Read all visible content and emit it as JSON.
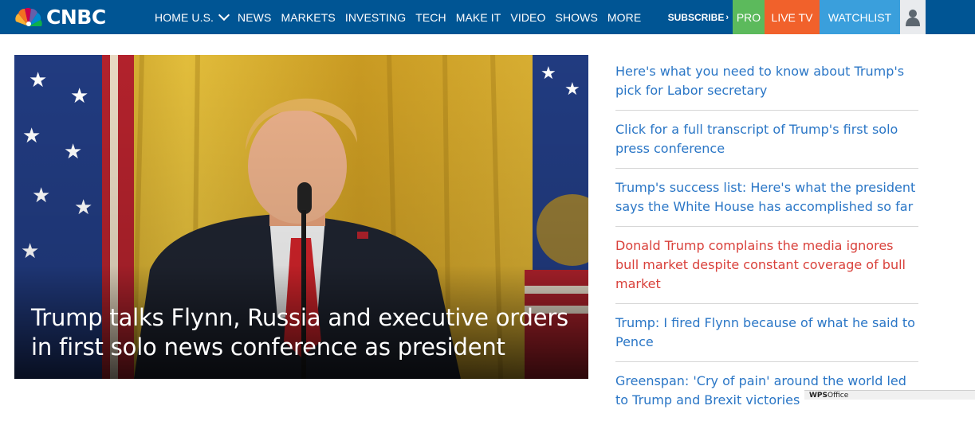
{
  "nav": {
    "logo_text": "CNBC",
    "menu": [
      {
        "label": "HOME U.S.",
        "has_dropdown": true
      },
      {
        "label": "NEWS"
      },
      {
        "label": "MARKETS"
      },
      {
        "label": "INVESTING"
      },
      {
        "label": "TECH"
      },
      {
        "label": "MAKE IT"
      },
      {
        "label": "VIDEO"
      },
      {
        "label": "SHOWS"
      },
      {
        "label": "MORE"
      }
    ],
    "subscribe_label": "SUBSCRIBE",
    "subscribe_arrow": "›",
    "pro_label": "PRO",
    "livetv_label": "LIVE TV",
    "watchlist_label": "WATCHLIST",
    "colors": {
      "bar": "#005594",
      "pro": "#5cba5c",
      "livetv": "#f1612b",
      "watchlist": "#3a9fdc",
      "user": "#e9ebee"
    }
  },
  "hero": {
    "headline_line1": "Trump talks Flynn, Russia and executive orders",
    "headline_line2": "in first solo news conference as president"
  },
  "headlines": [
    {
      "text": "Here's what you need to know about Trump's pick for Labor secretary",
      "color": "#2a76c6"
    },
    {
      "text": "Click for a full transcript of Trump's first solo press conference",
      "color": "#2a76c6"
    },
    {
      "text": "Trump's success list: Here's what the president says the White House has accomplished so far",
      "color": "#2a76c6"
    },
    {
      "text": "Donald Trump complains the media ignores bull market despite constant coverage of bull market",
      "color": "#d9413b"
    },
    {
      "text": "Trump: I fired Flynn because of what he said to Pence",
      "color": "#2a76c6"
    },
    {
      "text": "Greenspan: 'Cry of pain' around the world led to Trump and Brexit victories",
      "color": "#2a76c6"
    }
  ],
  "wps": {
    "brand": "WPS",
    "product": "Office"
  }
}
